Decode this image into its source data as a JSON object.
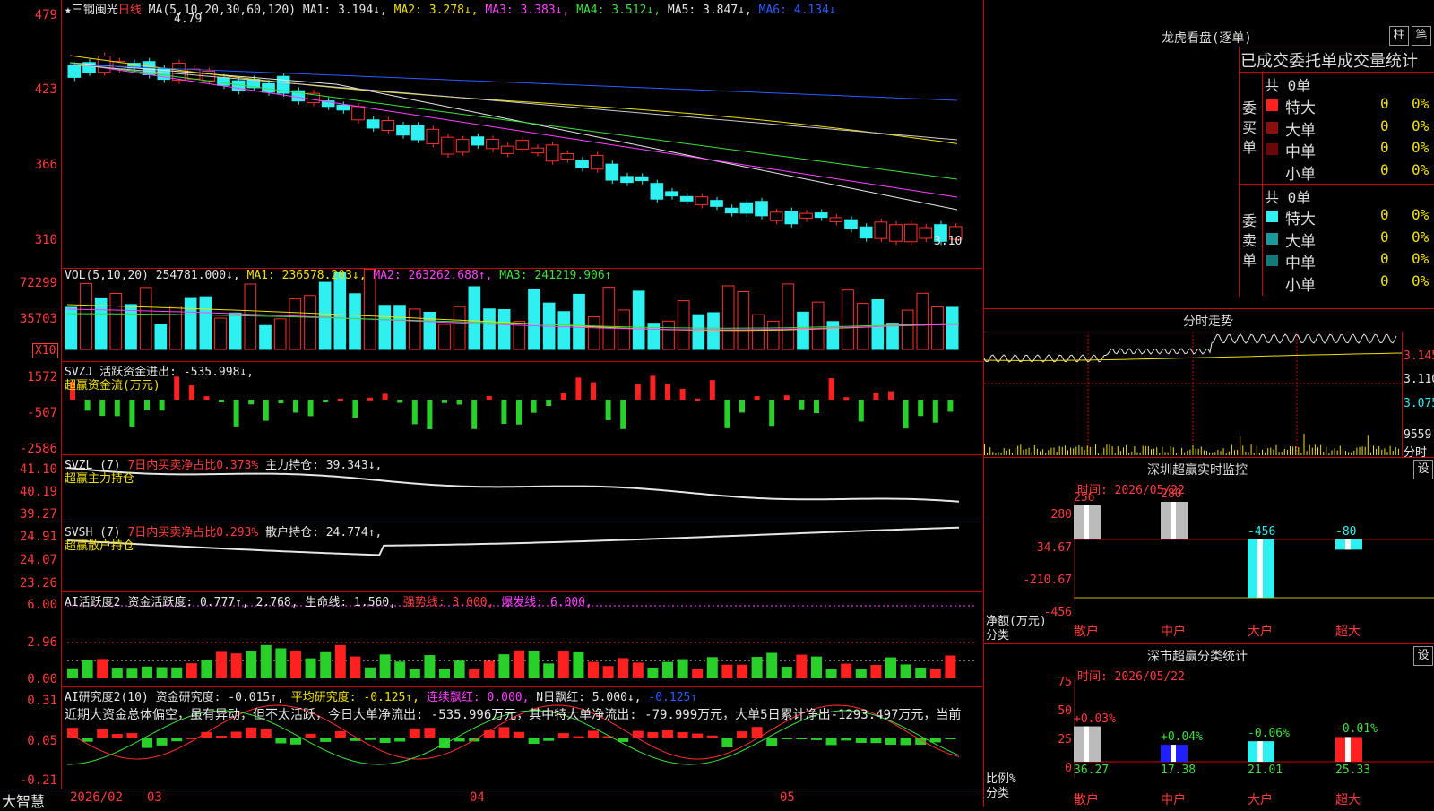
{
  "stock": {
    "title": "★三钢闽光",
    "period": "日线",
    "ma_label": "MA(5,10,20,30,60,120)",
    "ma1": "MA1: 3.194↓,",
    "ma2": "MA2: 3.278↓,",
    "ma3": "MA3: 3.383↓,",
    "ma4": "MA4: 3.512↓,",
    "ma5": "MA5: 3.847↓,",
    "ma6": "MA6: 4.134↓",
    "high_mark": "4.79",
    "low_mark": "3.10",
    "y_labels": [
      "479",
      "423",
      "366",
      "310"
    ]
  },
  "vol": {
    "label": "VOL(5,10,20)",
    "value": "254781.000↓,",
    "ma1": "MA1: 236578.203↓,",
    "ma2": "MA2: 263262.688↑,",
    "ma3": "MA3: 241219.906↑",
    "y_labels": [
      "72299",
      "35703"
    ],
    "unit": "X10"
  },
  "svzj": {
    "label": "SVZJ",
    "line": "活跃资金进出: -535.998↓,",
    "sub": "超赢资金流(万元)",
    "y_labels": [
      "1572",
      "-507",
      "-2586"
    ]
  },
  "svzl": {
    "label": "SVZL (7)",
    "ratio": "7日内买卖净占比0.373%",
    "hold": "主力持仓: 39.343↓,",
    "sub": "超赢主力持仓",
    "y_labels": [
      "41.10",
      "40.19",
      "39.27"
    ]
  },
  "svsh": {
    "label": "SVSH (7)",
    "ratio": "7日内买卖净占比0.293%",
    "hold": "散户持仓: 24.774↑,",
    "sub": "超赢散户持仓",
    "y_labels": [
      "24.91",
      "24.07",
      "23.26"
    ]
  },
  "ai_act": {
    "label": "AI活跃度2",
    "a": "资金活跃度: 0.777↑,",
    "b": "2.768,",
    "c": "生命线: 1.560,",
    "d": "强势线: 3.000,",
    "e": "爆发线: 6.000,",
    "y_labels": [
      "6.00",
      "2.96",
      "0.00"
    ]
  },
  "ai_res": {
    "label": "AI研究度2(10)",
    "a": "资金研究度: -0.015↑,",
    "b": "平均研究度: -0.125↑,",
    "c": "连续飘红: 0.000,",
    "d": "N日飘红: 5.000↓,",
    "e": "-0.125↑",
    "comment": "近期大资金总体偏空，虽有异动，但不太活跃，今日大单净流出: -535.996万元，其中特大单净流出: -79.999万元，大单5日累计净出-1293.497万元，当前",
    "y_labels": [
      "0.31",
      "0.05",
      "-0.21"
    ]
  },
  "xaxis": {
    "brand": "大智慧",
    "labels": [
      "2026/02",
      "03",
      "04",
      "05"
    ]
  },
  "dragon": {
    "title": "龙虎看盘(逐单)",
    "btn_bar": "柱",
    "btn_pen": "笔",
    "header": "已成交委托单成交量统计",
    "buy_label": "委买单",
    "sell_label": "委卖单",
    "buy_total": "共 0单",
    "sell_total": "共 0单",
    "buy_rows": [
      {
        "name": "特大",
        "count": "0",
        "pct": "0%",
        "color": "#ff2020"
      },
      {
        "name": "大单",
        "count": "0",
        "pct": "0%",
        "color": "#8a1010"
      },
      {
        "name": "中单",
        "count": "0",
        "pct": "0%",
        "color": "#6a0808"
      },
      {
        "name": "小单",
        "count": "0",
        "pct": "0%",
        "color": "#000000"
      }
    ],
    "sell_rows": [
      {
        "name": "特大",
        "count": "0",
        "pct": "0%",
        "color": "#2ef0f0"
      },
      {
        "name": "大单",
        "count": "0",
        "pct": "0%",
        "color": "#1a9a9a"
      },
      {
        "name": "中单",
        "count": "0",
        "pct": "0%",
        "color": "#137a7a"
      },
      {
        "name": "小单",
        "count": "0",
        "pct": "0%",
        "color": "#000000"
      }
    ]
  },
  "intraday": {
    "title": "分时走势",
    "y_labels": [
      "3.145",
      "3.110",
      "3.075"
    ],
    "vol_label": "9559",
    "time_label": "分时"
  },
  "monitor": {
    "title": "深圳超赢实时监控",
    "btn": "设",
    "time": "时间: 2026/05/22",
    "y_labels": [
      "280",
      "34.67",
      "-210.67",
      "-456"
    ],
    "net_label": "净额(万元)",
    "cat_label": "分类",
    "categories": [
      "散户",
      "中户",
      "大户",
      "超大"
    ],
    "values": [
      256,
      280,
      -456,
      -80
    ],
    "value_labels": [
      "256",
      "280",
      "-456",
      "-80"
    ]
  },
  "classify": {
    "title": "深市超赢分类统计",
    "btn": "设",
    "time": "时间: 2026/05/22",
    "y_labels": [
      "75",
      "50",
      "25",
      "0"
    ],
    "ratio_label": "比例%",
    "cat_label": "分类",
    "categories": [
      "散户",
      "中户",
      "大户",
      "超大"
    ],
    "values": [
      36.27,
      17.38,
      21.01,
      25.33
    ],
    "value_labels": [
      "36.27",
      "17.38",
      "21.01",
      "25.33"
    ],
    "change_labels": [
      "+0.03%",
      "+0.04%",
      "-0.06%",
      "-0.01%"
    ]
  }
}
